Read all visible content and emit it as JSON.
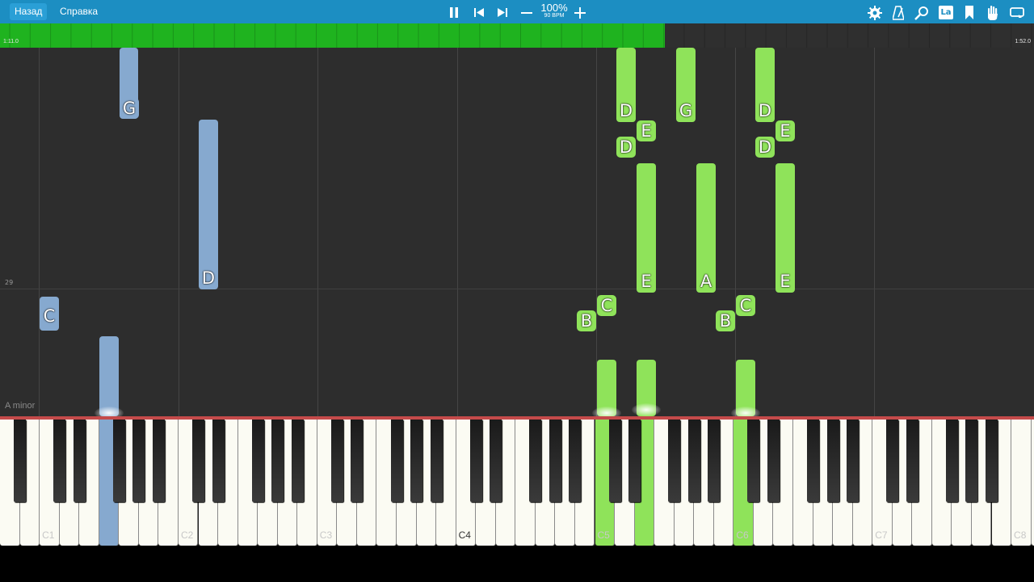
{
  "toolbar": {
    "back_label": "Назад",
    "help_label": "Справка",
    "tempo_percent": "100%",
    "tempo_bpm": "90 BPM",
    "icons": [
      "pause-icon",
      "skip-back-icon",
      "skip-forward-icon",
      "minus-icon",
      "plus-icon",
      "gear-icon",
      "metronome-icon",
      "magnifier-icon",
      "la-icon",
      "bookmark-icon",
      "hand-icon",
      "loop-icon"
    ],
    "la_label": "La"
  },
  "progress": {
    "current_time": "1:11.0",
    "total_time": "1:52.0",
    "fraction": 0.643,
    "color": "#1fb31f"
  },
  "roll": {
    "measure_number": "29",
    "key_signature": "A minor"
  },
  "notes": [
    {
      "label": "G",
      "color": "blue"
    },
    {
      "label": "D",
      "color": "blue"
    },
    {
      "label": "C",
      "color": "blue"
    },
    {
      "label": "",
      "color": "blue"
    },
    {
      "label": "D",
      "color": "green"
    },
    {
      "label": "G",
      "color": "green"
    },
    {
      "label": "D",
      "color": "green"
    },
    {
      "label": "E",
      "color": "green"
    },
    {
      "label": "E",
      "color": "green"
    },
    {
      "label": "D",
      "color": "green"
    },
    {
      "label": "D",
      "color": "green"
    },
    {
      "label": "E",
      "color": "green"
    },
    {
      "label": "A",
      "color": "green"
    },
    {
      "label": "E",
      "color": "green"
    },
    {
      "label": "C",
      "color": "green"
    },
    {
      "label": "C",
      "color": "green"
    },
    {
      "label": "B",
      "color": "green"
    },
    {
      "label": "B",
      "color": "green"
    },
    {
      "label": "",
      "color": "green"
    },
    {
      "label": "",
      "color": "green"
    },
    {
      "label": "",
      "color": "green"
    }
  ],
  "keyboard": {
    "octave_labels": [
      "C1",
      "C2",
      "C3",
      "C4",
      "C5",
      "C6",
      "C7",
      "C8"
    ]
  },
  "colors": {
    "toolbar": "#1c8ec2",
    "blue_note": "#86a9cf",
    "green_note": "#8fe35a"
  }
}
